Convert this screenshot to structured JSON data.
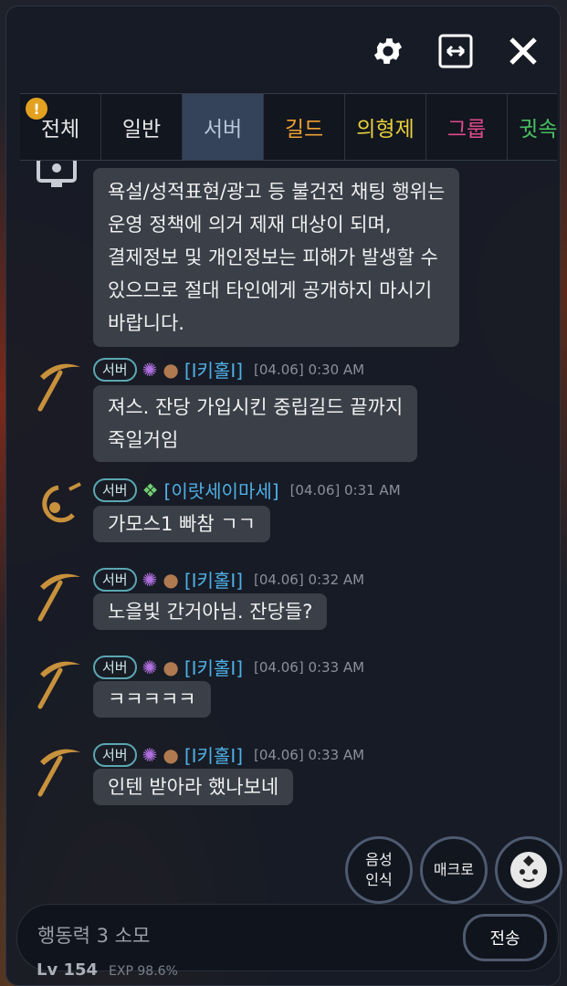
{
  "tabs": [
    {
      "label": "전체",
      "color": "#ffffff",
      "alert": "!"
    },
    {
      "label": "일반",
      "color": "#ffffff"
    },
    {
      "label": "서버",
      "color": "#b7c6d8"
    },
    {
      "label": "길드",
      "color": "#f0a030"
    },
    {
      "label": "의형제",
      "color": "#e8d03a"
    },
    {
      "label": "그룹",
      "color": "#e04a8e"
    },
    {
      "label": "귓속말",
      "color": "#48c060"
    }
  ],
  "system_message": {
    "lines": [
      "욕설/성적표현/광고 등 불건전 채팅 행위는",
      "운영 정책에 의거 제재 대상이 되며,",
      "결제정보 및 개인정보는 피해가 발생할 수",
      "있으므로 절대 타인에게 공개하지 마시기",
      "바랍니다."
    ]
  },
  "messages": [
    {
      "badge": "서버",
      "name": "[I키홀I]",
      "time": "[04.06] 0:30 AM",
      "lines": [
        "져스. 잔당 가입시킨 중립길드 끝까지",
        "죽일거임"
      ]
    },
    {
      "badge": "서버",
      "name": "[이랏세이마세]",
      "time": "[04.06] 0:31 AM",
      "lines": [
        "가모스1 빠참 ㄱㄱ"
      ]
    },
    {
      "badge": "서버",
      "name": "[I키홀I]",
      "time": "[04.06] 0:32 AM",
      "lines": [
        "노을빛 간거아님. 잔당들?"
      ]
    },
    {
      "badge": "서버",
      "name": "[I키홀I]",
      "time": "[04.06] 0:33 AM",
      "lines": [
        "ㅋㅋㅋㅋㅋ"
      ]
    },
    {
      "badge": "서버",
      "name": "[I키홀I]",
      "time": "[04.06] 0:33 AM",
      "lines": [
        "인텐 받아라 했나보네"
      ]
    }
  ],
  "buttons": {
    "voice": [
      "음성",
      "인식"
    ],
    "macro": "매크로"
  },
  "input": {
    "placeholder": "행동력 3 소모",
    "send": "전송"
  },
  "footer": {
    "level": "Lv 154",
    "exp": "EXP 98.6%"
  }
}
